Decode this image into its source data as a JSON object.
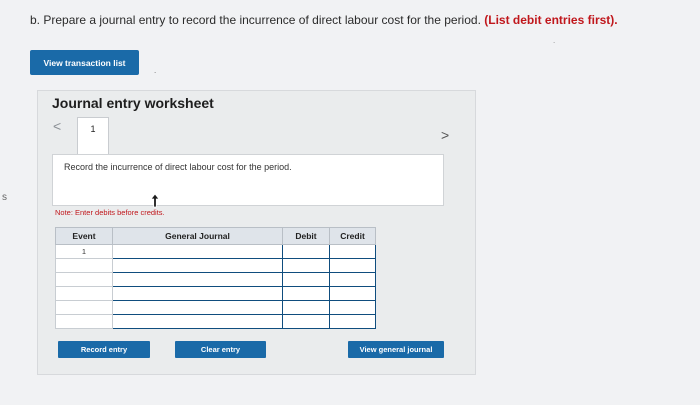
{
  "margin_mark": "s",
  "question": {
    "text": "b. Prepare a journal entry to record the incurrence of direct labour cost for the period.",
    "emphasis": "(List debit entries first)."
  },
  "toolbar": {
    "view_transactions_label": "View transaction list"
  },
  "worksheet": {
    "title": "Journal entry worksheet",
    "current_tab": "1",
    "instruction": "Record the incurrence of direct labour cost for the period.",
    "note": "Note: Enter debits before credits."
  },
  "journal_table": {
    "headers": {
      "event": "Event",
      "general_journal": "General Journal",
      "debit": "Debit",
      "credit": "Credit"
    },
    "rows": [
      {
        "event": "1",
        "account": "",
        "debit": "",
        "credit": ""
      },
      {
        "event": "",
        "account": "",
        "debit": "",
        "credit": ""
      },
      {
        "event": "",
        "account": "",
        "debit": "",
        "credit": ""
      },
      {
        "event": "",
        "account": "",
        "debit": "",
        "credit": ""
      },
      {
        "event": "",
        "account": "",
        "debit": "",
        "credit": ""
      },
      {
        "event": "",
        "account": "",
        "debit": "",
        "credit": ""
      }
    ]
  },
  "actions": {
    "record_entry": "Record entry",
    "clear_entry": "Clear entry",
    "view_general_journal": "View general journal"
  },
  "colors": {
    "accent": "#1a6aa8",
    "emphasis": "#c0171c"
  }
}
